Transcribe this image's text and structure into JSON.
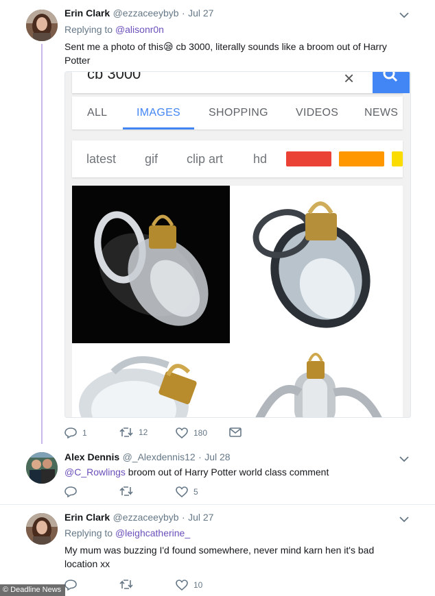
{
  "tweets": [
    {
      "name": "Erin Clark",
      "handle": "@ezzaceeybyb",
      "date": "Jul 27",
      "replying_label": "Replying to",
      "replying_to": "@alisonr0n",
      "text_part1": "Sent me a photo of this",
      "emoji": "😪",
      "text_part2": " cb 3000, literally sounds like a broom out of Harry Potter",
      "actions": {
        "replies": "1",
        "retweets": "12",
        "likes": "180"
      }
    },
    {
      "name": "Alex Dennis",
      "handle": "@_Alexdennis12",
      "date": "Jul 28",
      "mention": "@C_Rowlings",
      "text": " broom out of Harry Potter world class comment",
      "actions": {
        "replies": "",
        "retweets": "",
        "likes": "5"
      }
    },
    {
      "name": "Erin Clark",
      "handle": "@ezzaceeybyb",
      "date": "Jul 27",
      "replying_label": "Replying to",
      "replying_to": "@leighcatherine_",
      "text": "My mum was buzzing I'd found somewhere, never mind karn hen it's bad location xx",
      "actions": {
        "replies": "",
        "retweets": "",
        "likes": "10"
      }
    }
  ],
  "embed": {
    "query": "cb 3000",
    "clear_glyph": "×",
    "tabs": [
      "ALL",
      "IMAGES",
      "SHOPPING",
      "VIDEOS",
      "NEWS"
    ],
    "active_tab": "IMAGES",
    "chips": [
      "latest",
      "gif",
      "clip art",
      "hd"
    ],
    "swatch_colors": [
      "#ea4335",
      "#ff9800",
      "#fbdc00"
    ]
  },
  "separator": "·",
  "watermark": "© Deadline News",
  "colors": {
    "accent": "#6b4fbb",
    "google_blue": "#4285f4",
    "thread_line": "#c9b8ee"
  },
  "icons": [
    "reply-icon",
    "retweet-icon",
    "like-icon",
    "message-icon",
    "chevron-down-icon",
    "search-icon"
  ]
}
